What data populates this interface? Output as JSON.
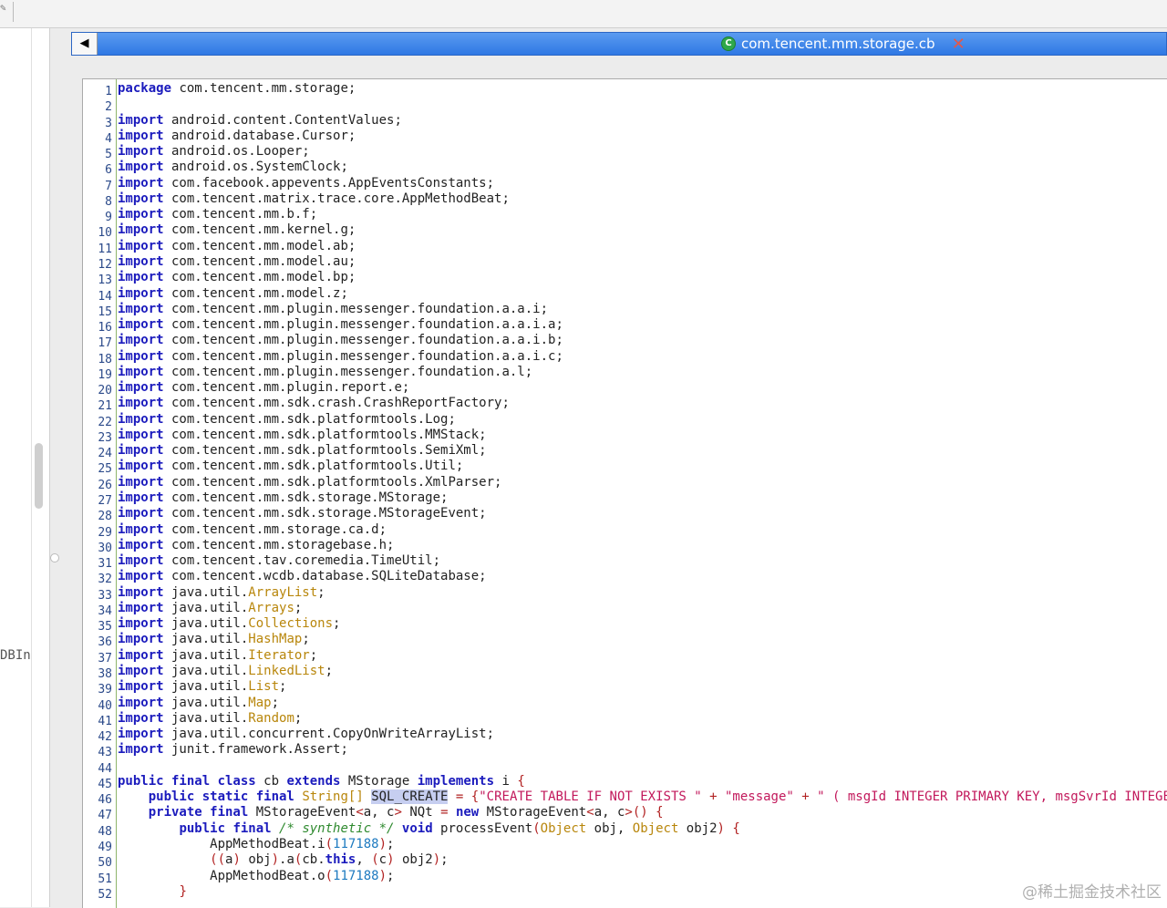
{
  "editor": {
    "tab_title": "com.tencent.mm.storage.cb",
    "tab_icon_letter": "C",
    "back_label": "◀",
    "close_label": "✕"
  },
  "left_panel": {
    "partial_text": "DBInf"
  },
  "watermark": "@稀土掘金技术社区",
  "line_numbers": [
    "1",
    "2",
    "3",
    "4",
    "5",
    "6",
    "7",
    "8",
    "9",
    "10",
    "11",
    "12",
    "13",
    "14",
    "15",
    "16",
    "17",
    "18",
    "19",
    "20",
    "21",
    "22",
    "23",
    "24",
    "25",
    "26",
    "27",
    "28",
    "29",
    "30",
    "31",
    "32",
    "33",
    "34",
    "35",
    "36",
    "37",
    "38",
    "39",
    "40",
    "41",
    "42",
    "43",
    "44",
    "45",
    "46",
    "47",
    "48",
    "49",
    "50",
    "51",
    "52"
  ],
  "code_lines": [
    [
      [
        "kw",
        "package"
      ],
      [
        "",
        " com.tencent.mm.storage;"
      ]
    ],
    [],
    [
      [
        "kw",
        "import"
      ],
      [
        "",
        " android.content.ContentValues;"
      ]
    ],
    [
      [
        "kw",
        "import"
      ],
      [
        "",
        " android.database.Cursor;"
      ]
    ],
    [
      [
        "kw",
        "import"
      ],
      [
        "",
        " android.os.Looper;"
      ]
    ],
    [
      [
        "kw",
        "import"
      ],
      [
        "",
        " android.os.SystemClock;"
      ]
    ],
    [
      [
        "kw",
        "import"
      ],
      [
        "",
        " com.facebook.appevents.AppEventsConstants;"
      ]
    ],
    [
      [
        "kw",
        "import"
      ],
      [
        "",
        " com.tencent.matrix.trace.core.AppMethodBeat;"
      ]
    ],
    [
      [
        "kw",
        "import"
      ],
      [
        "",
        " com.tencent.mm.b.f;"
      ]
    ],
    [
      [
        "kw",
        "import"
      ],
      [
        "",
        " com.tencent.mm.kernel.g;"
      ]
    ],
    [
      [
        "kw",
        "import"
      ],
      [
        "",
        " com.tencent.mm.model.ab;"
      ]
    ],
    [
      [
        "kw",
        "import"
      ],
      [
        "",
        " com.tencent.mm.model.au;"
      ]
    ],
    [
      [
        "kw",
        "import"
      ],
      [
        "",
        " com.tencent.mm.model.bp;"
      ]
    ],
    [
      [
        "kw",
        "import"
      ],
      [
        "",
        " com.tencent.mm.model.z;"
      ]
    ],
    [
      [
        "kw",
        "import"
      ],
      [
        "",
        " com.tencent.mm.plugin.messenger.foundation.a.a.i;"
      ]
    ],
    [
      [
        "kw",
        "import"
      ],
      [
        "",
        " com.tencent.mm.plugin.messenger.foundation.a.a.i.a;"
      ]
    ],
    [
      [
        "kw",
        "import"
      ],
      [
        "",
        " com.tencent.mm.plugin.messenger.foundation.a.a.i.b;"
      ]
    ],
    [
      [
        "kw",
        "import"
      ],
      [
        "",
        " com.tencent.mm.plugin.messenger.foundation.a.a.i.c;"
      ]
    ],
    [
      [
        "kw",
        "import"
      ],
      [
        "",
        " com.tencent.mm.plugin.messenger.foundation.a.l;"
      ]
    ],
    [
      [
        "kw",
        "import"
      ],
      [
        "",
        " com.tencent.mm.plugin.report.e;"
      ]
    ],
    [
      [
        "kw",
        "import"
      ],
      [
        "",
        " com.tencent.mm.sdk.crash.CrashReportFactory;"
      ]
    ],
    [
      [
        "kw",
        "import"
      ],
      [
        "",
        " com.tencent.mm.sdk.platformtools.Log;"
      ]
    ],
    [
      [
        "kw",
        "import"
      ],
      [
        "",
        " com.tencent.mm.sdk.platformtools.MMStack;"
      ]
    ],
    [
      [
        "kw",
        "import"
      ],
      [
        "",
        " com.tencent.mm.sdk.platformtools.SemiXml;"
      ]
    ],
    [
      [
        "kw",
        "import"
      ],
      [
        "",
        " com.tencent.mm.sdk.platformtools.Util;"
      ]
    ],
    [
      [
        "kw",
        "import"
      ],
      [
        "",
        " com.tencent.mm.sdk.platformtools.XmlParser;"
      ]
    ],
    [
      [
        "kw",
        "import"
      ],
      [
        "",
        " com.tencent.mm.sdk.storage.MStorage;"
      ]
    ],
    [
      [
        "kw",
        "import"
      ],
      [
        "",
        " com.tencent.mm.sdk.storage.MStorageEvent;"
      ]
    ],
    [
      [
        "kw",
        "import"
      ],
      [
        "",
        " com.tencent.mm.storage.ca.d;"
      ]
    ],
    [
      [
        "kw",
        "import"
      ],
      [
        "",
        " com.tencent.mm.storagebase.h;"
      ]
    ],
    [
      [
        "kw",
        "import"
      ],
      [
        "",
        " com.tencent.tav.coremedia.TimeUtil;"
      ]
    ],
    [
      [
        "kw",
        "import"
      ],
      [
        "",
        " com.tencent.wcdb.database.SQLiteDatabase;"
      ]
    ],
    [
      [
        "kw",
        "import"
      ],
      [
        "",
        " java.util."
      ],
      [
        "ty",
        "ArrayList"
      ],
      [
        "",
        ";"
      ]
    ],
    [
      [
        "kw",
        "import"
      ],
      [
        "",
        " java.util."
      ],
      [
        "ty",
        "Arrays"
      ],
      [
        "",
        ";"
      ]
    ],
    [
      [
        "kw",
        "import"
      ],
      [
        "",
        " java.util."
      ],
      [
        "ty",
        "Collections"
      ],
      [
        "",
        ";"
      ]
    ],
    [
      [
        "kw",
        "import"
      ],
      [
        "",
        " java.util."
      ],
      [
        "ty",
        "HashMap"
      ],
      [
        "",
        ";"
      ]
    ],
    [
      [
        "kw",
        "import"
      ],
      [
        "",
        " java.util."
      ],
      [
        "ty",
        "Iterator"
      ],
      [
        "",
        ";"
      ]
    ],
    [
      [
        "kw",
        "import"
      ],
      [
        "",
        " java.util."
      ],
      [
        "ty",
        "LinkedList"
      ],
      [
        "",
        ";"
      ]
    ],
    [
      [
        "kw",
        "import"
      ],
      [
        "",
        " java.util."
      ],
      [
        "ty",
        "List"
      ],
      [
        "",
        ";"
      ]
    ],
    [
      [
        "kw",
        "import"
      ],
      [
        "",
        " java.util."
      ],
      [
        "ty",
        "Map"
      ],
      [
        "",
        ";"
      ]
    ],
    [
      [
        "kw",
        "import"
      ],
      [
        "",
        " java.util."
      ],
      [
        "ty",
        "Random"
      ],
      [
        "",
        ";"
      ]
    ],
    [
      [
        "kw",
        "import"
      ],
      [
        "",
        " java.util.concurrent.CopyOnWriteArrayList;"
      ]
    ],
    [
      [
        "kw",
        "import"
      ],
      [
        "",
        " junit.framework.Assert;"
      ]
    ],
    [],
    [
      [
        "kw",
        "public final class"
      ],
      [
        "",
        " cb "
      ],
      [
        "kw",
        "extends"
      ],
      [
        "",
        " MStorage "
      ],
      [
        "kw",
        "implements"
      ],
      [
        "",
        " i "
      ],
      [
        "pun",
        "{"
      ]
    ],
    [
      [
        "",
        "    "
      ],
      [
        "kw",
        "public static final"
      ],
      [
        "",
        " "
      ],
      [
        "ty",
        "String[]"
      ],
      [
        "",
        " "
      ],
      [
        "sel",
        "SQL_CREATE"
      ],
      [
        "",
        " "
      ],
      [
        "pun",
        "="
      ],
      [
        "",
        " "
      ],
      [
        "pun",
        "{"
      ],
      [
        "str",
        "\"CREATE TABLE IF NOT EXISTS \""
      ],
      [
        "",
        " "
      ],
      [
        "pun",
        "+"
      ],
      [
        "",
        " "
      ],
      [
        "str",
        "\"message\""
      ],
      [
        "",
        " "
      ],
      [
        "pun",
        "+"
      ],
      [
        "",
        " "
      ],
      [
        "str",
        "\" ( msgId INTEGER PRIMARY KEY, msgSvrId INTEGER , ty"
      ]
    ],
    [
      [
        "",
        "    "
      ],
      [
        "kw",
        "private final"
      ],
      [
        "",
        " MStorageEvent"
      ],
      [
        "pun",
        "<"
      ],
      [
        "",
        "a, c"
      ],
      [
        "pun",
        ">"
      ],
      [
        "",
        " NQt "
      ],
      [
        "pun",
        "="
      ],
      [
        "",
        " "
      ],
      [
        "kw",
        "new"
      ],
      [
        "",
        " MStorageEvent"
      ],
      [
        "pun",
        "<"
      ],
      [
        "",
        "a, c"
      ],
      [
        "pun",
        ">() {"
      ]
    ],
    [
      [
        "",
        "        "
      ],
      [
        "kw",
        "public final"
      ],
      [
        "",
        " "
      ],
      [
        "cm",
        "/* synthetic */"
      ],
      [
        "",
        " "
      ],
      [
        "kw",
        "void"
      ],
      [
        "",
        " processEvent"
      ],
      [
        "pun",
        "("
      ],
      [
        "ty",
        "Object"
      ],
      [
        "",
        " obj, "
      ],
      [
        "ty",
        "Object"
      ],
      [
        "",
        " obj2"
      ],
      [
        "pun",
        ") {"
      ]
    ],
    [
      [
        "",
        "            AppMethodBeat.i"
      ],
      [
        "pun",
        "("
      ],
      [
        "num",
        "117188"
      ],
      [
        "pun",
        ")"
      ],
      [
        "",
        ";"
      ]
    ],
    [
      [
        "",
        "            "
      ],
      [
        "pun",
        "(("
      ],
      [
        "",
        "a"
      ],
      [
        "pun",
        ")"
      ],
      [
        "",
        " obj"
      ],
      [
        "pun",
        ")"
      ],
      [
        "",
        ".a"
      ],
      [
        "pun",
        "("
      ],
      [
        "",
        "cb."
      ],
      [
        "kw",
        "this"
      ],
      [
        "",
        ", "
      ],
      [
        "pun",
        "("
      ],
      [
        "",
        "c"
      ],
      [
        "pun",
        ")"
      ],
      [
        "",
        " obj2"
      ],
      [
        "pun",
        ")"
      ],
      [
        "",
        ";"
      ]
    ],
    [
      [
        "",
        "            AppMethodBeat.o"
      ],
      [
        "pun",
        "("
      ],
      [
        "num",
        "117188"
      ],
      [
        "pun",
        ")"
      ],
      [
        "",
        ";"
      ]
    ],
    [
      [
        "",
        "        "
      ],
      [
        "pun",
        "}"
      ]
    ]
  ]
}
